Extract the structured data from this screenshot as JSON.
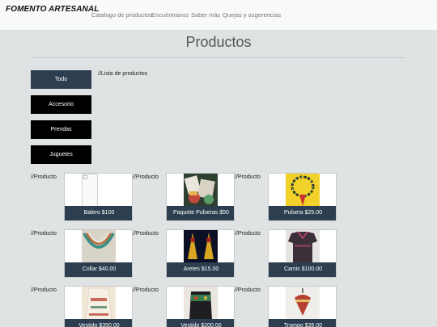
{
  "navbar": {
    "brand": "FOMENTO ARTESANAL",
    "links": [
      "Catalogo de productos",
      "Encuéntranos",
      "Saber más",
      "Quejas y sugerencias"
    ]
  },
  "page": {
    "title": "Productos"
  },
  "categories": [
    "Todo",
    "Accesorio",
    "Prendas",
    "Juguetes"
  ],
  "list_comment": "//Lista de productos",
  "product_comment": "//Producto",
  "products": [
    {
      "caption": "Balero $100",
      "image": "broken-image-icon"
    },
    {
      "caption": "Paquete Pulseras $50",
      "image": "bracelets-photo"
    },
    {
      "caption": "Pulsera $25.00",
      "image": "bracelet-photo"
    },
    {
      "caption": "Collar $40.00",
      "image": "necklace-photo"
    },
    {
      "caption": "Aretes $15.00",
      "image": "earrings-photo"
    },
    {
      "caption": "Camis $100.00",
      "image": "shirt-photo"
    },
    {
      "caption": "Vestido $350.00",
      "image": "dress-photo"
    },
    {
      "caption": "Vestido $200.00",
      "image": "dress-photo"
    },
    {
      "caption": "Trompo $35.00",
      "image": "spinning-top-photo"
    }
  ],
  "colors": {
    "navbar_bg": "#f8f9fa",
    "page_bg": "#dfe3e4",
    "accent": "#2c3e50",
    "button_dark": "#000000"
  }
}
